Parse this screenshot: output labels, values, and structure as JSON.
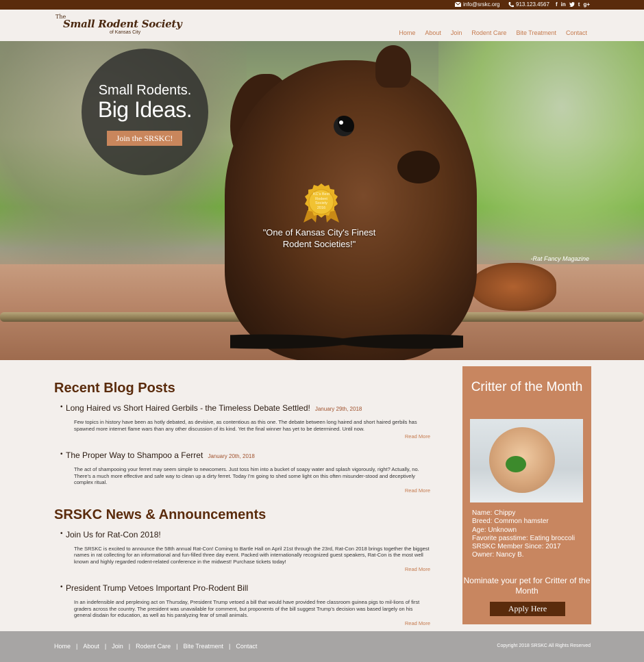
{
  "topbar": {
    "email": "info@srskc.org",
    "phone": "913.123.4567",
    "social": [
      "f",
      "in",
      "t",
      "g+"
    ],
    "icons": [
      "envelope-icon",
      "phone-icon",
      "facebook-icon",
      "linkedin-icon",
      "twitter-icon",
      "tumblr-icon",
      "google-plus-icon"
    ]
  },
  "logo": {
    "the": "The",
    "main": "Small Rodent Society",
    "sub": "of Kansas City"
  },
  "nav": [
    "Home",
    "About",
    "Join",
    "Rodent Care",
    "Bite Treatment",
    "Contact"
  ],
  "hero": {
    "line1": "Small Rodents.",
    "line2": "Big Ideas.",
    "cta": "Join the SRSKC!",
    "badge": [
      "KC's Best",
      "Rodent",
      "Society",
      "2016"
    ],
    "quote": "\"One of Kansas City's Finest Rodent Societies!\"",
    "attribution": "-Rat Fancy Magazine"
  },
  "blog": {
    "title": "Recent Blog Posts",
    "posts": [
      {
        "title": "Long Haired vs Short Haired Gerbils - the Timeless Debate Settled!",
        "date": "January 29th, 2018",
        "body": "Few topics in history have been as hotly debated, as devisive, as contentious as this one. The debate between long haired and short haired gerbils has spawned more internet flame wars than any other discussion of its kind. Yet the final winner has yet to be determined. Until now.",
        "more": "Read More"
      },
      {
        "title": "The Proper Way to Shampoo a Ferret",
        "date": "January 20th, 2018",
        "body": "The act of shampooing your ferret may seem simple to newcomers. Just toss him into a bucket of soapy water and splash vigorously, right? Actually, no. There's a much more effective and safe way to clean up a dirty ferret. Today I'm going to shed some light on this often misunder-stood and deceptively complex ritual.",
        "more": "Read More"
      }
    ]
  },
  "news": {
    "title": "SRSKC News & Announcements",
    "posts": [
      {
        "title": "Join Us for Rat-Con 2018!",
        "body": "The SRSKC is excited to announce the 58th annual Rat-Con! Coming to Bartle Hall on April 21st through the 23rd, Rat-Con 2018 brings together the biggest names in rat collecting for an informational and fun-filled three day event. Packed with internationally recognized guest speakers, Rat-Con is the most well known and highly regarded rodent-related conference in the midwest! Purchase tickets today!",
        "more": "Read More"
      },
      {
        "title": "President Trump Vetoes Important Pro-Rodent Bill",
        "body": "In an indefensible and perplexing act on Thursday, President Trump vetoed a bill that would have provided free classroom guinea pigs to mil-lions of first graders across the country. The president was unavailable for comment, but proponents of the bill suggest Trump's decision was based largely on his general disdain for education, as well as his paralyzing fear of small animals.",
        "more": "Read More"
      }
    ]
  },
  "critter": {
    "title": "Critter of the Month",
    "info": [
      "Name: Chippy",
      "Breed: Common hamster",
      "Age: Unknown",
      "Favorite passtime: Eating broccoli",
      "SRSKC Member Since: 2017",
      "Owner: Nancy B."
    ],
    "nominate": "Nominate your pet for Critter of the Month",
    "apply": "Apply Here"
  },
  "footer": {
    "links": [
      "Home",
      "About",
      "Join",
      "Rodent Care",
      "Bite Treatment",
      "Contact"
    ],
    "separator": "|",
    "copyright": "Copyright 2018 SRSKC All Rights Reserved"
  },
  "colors": {
    "topbar": "#5a2b0c",
    "accent": "#c57a4e",
    "sidebar": "#c88660",
    "footer": "#a7a5a4",
    "background": "#f3efec"
  }
}
